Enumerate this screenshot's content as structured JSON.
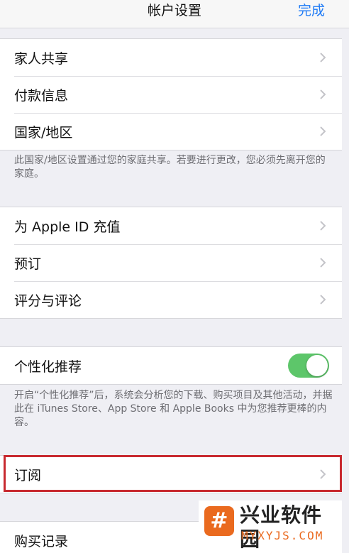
{
  "nav": {
    "title": "帐户设置",
    "done": "完成"
  },
  "group1": {
    "items": [
      {
        "label": "家人共享"
      },
      {
        "label": "付款信息"
      },
      {
        "label": "国家/地区"
      }
    ],
    "note": "此国家/地区设置通过您的家庭共享。若要进行更改，您必须先离开您的家庭。"
  },
  "group2": {
    "items": [
      {
        "label": "为 Apple ID 充值"
      },
      {
        "label": "预订"
      },
      {
        "label": "评分与评论"
      }
    ]
  },
  "group3": {
    "personalized": {
      "label": "个性化推荐",
      "enabled": true
    },
    "note": "开启“个性化推荐”后，系统会分析您的下载、购买项目及其他活动，并据此在 iTunes Store、App Store 和 Apple Books 中为您推荐更棒的内容。"
  },
  "group4": {
    "subscriptions": "订阅"
  },
  "group5": {
    "purchase_history": "购买记录"
  },
  "watermark": {
    "cn": "兴业软件园",
    "en": "MYXYJS.COM",
    "logo_char": "#"
  },
  "colors": {
    "accent": "#1f7bf6",
    "toggle_on": "#5dc66a",
    "highlight": "#c8292f"
  }
}
